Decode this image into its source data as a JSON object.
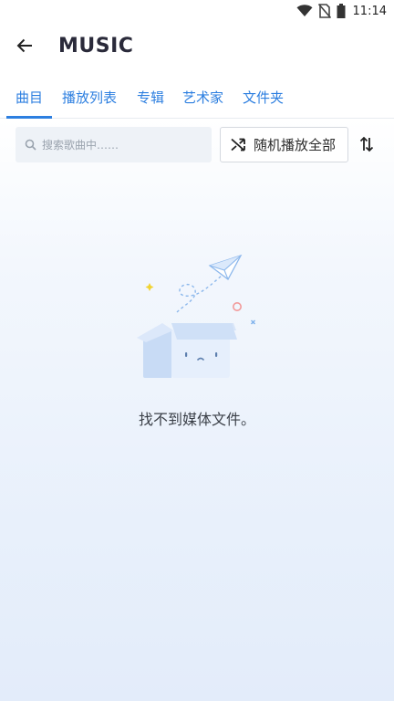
{
  "status_bar": {
    "time": "11:14",
    "icons": [
      "wifi-icon",
      "no-sim-icon",
      "battery-icon"
    ]
  },
  "header": {
    "title": "MUSIC",
    "back_icon": "arrow-left-icon"
  },
  "tabs": [
    {
      "label": "曲目",
      "active": true
    },
    {
      "label": "播放列表",
      "active": false
    },
    {
      "label": "专辑",
      "active": false
    },
    {
      "label": "艺术家",
      "active": false
    },
    {
      "label": "文件夹",
      "active": false
    }
  ],
  "search": {
    "placeholder": "搜索歌曲中……",
    "icon": "search-icon"
  },
  "shuffle_button": {
    "label": "随机播放全部",
    "icon": "shuffle-icon"
  },
  "sort_button": {
    "icon": "sort-arrows-icon"
  },
  "empty_state": {
    "message": "找不到媒体文件。",
    "illustration": "empty-box-paper-plane"
  },
  "colors": {
    "accent": "#2d7fe0",
    "title": "#2a2a3a",
    "search_bg": "#eef2f7"
  }
}
